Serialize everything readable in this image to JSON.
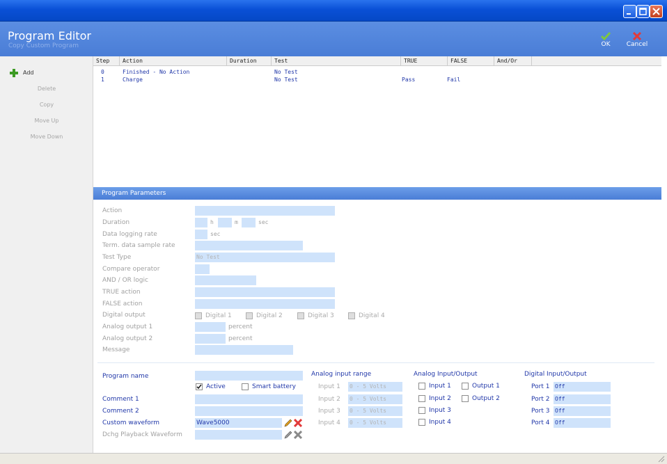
{
  "window": {
    "title": ""
  },
  "header": {
    "title": "Program Editor",
    "subtitle": "Copy Custom Program",
    "ok_label": "OK",
    "cancel_label": "Cancel"
  },
  "sidebar": {
    "items": [
      {
        "label": "Add",
        "enabled": true
      },
      {
        "label": "Delete",
        "enabled": false
      },
      {
        "label": "Copy",
        "enabled": false
      },
      {
        "label": "Move Up",
        "enabled": false
      },
      {
        "label": "Move Down",
        "enabled": false
      }
    ]
  },
  "table": {
    "columns": [
      "Step",
      "Action",
      "Duration",
      "Test",
      "TRUE",
      "FALSE",
      "And/Or"
    ],
    "rows": [
      {
        "step": "0",
        "action": "Finished - No Action",
        "duration": "",
        "test": "No Test",
        "true": "",
        "false": "",
        "andor": ""
      },
      {
        "step": "1",
        "action": "Charge",
        "duration": "",
        "test": "No Test",
        "true": "Pass",
        "false": "Fail",
        "andor": ""
      }
    ]
  },
  "params": {
    "section_title": "Program Parameters",
    "labels": {
      "action": "Action",
      "duration": "Duration",
      "data_logging_rate": "Data logging rate",
      "term_rate": "Term. data sample rate",
      "test_type": "Test Type",
      "compare_operator": "Compare operator",
      "and_or": "AND / OR logic",
      "true_action": "TRUE action",
      "false_action": "FALSE action",
      "digital_output": "Digital output",
      "analog_output_1": "Analog output 1",
      "analog_output_2": "Analog output 2",
      "message": "Message"
    },
    "units": {
      "h": "h",
      "m": "m",
      "sec": "sec",
      "percent": "percent"
    },
    "test_type_value": "No Test",
    "digital_outputs": [
      "Digital 1",
      "Digital 2",
      "Digital 3",
      "Digital 4"
    ]
  },
  "program": {
    "labels": {
      "name": "Program name",
      "comment1": "Comment 1",
      "comment2": "Comment 2",
      "custom_waveform": "Custom waveform",
      "dchg": "Dchg Playback Waveform"
    },
    "active_label": "Active",
    "active_checked": true,
    "smart_battery_label": "Smart battery",
    "smart_battery_checked": false,
    "custom_waveform_value": "Wave5000"
  },
  "analog_range": {
    "title": "Analog input range",
    "inputs": [
      {
        "label": "Input 1",
        "value": "0 -  5 Volts"
      },
      {
        "label": "Input 2",
        "value": "0 -  5 Volts"
      },
      {
        "label": "Input 3",
        "value": "0 -  5 Volts"
      },
      {
        "label": "Input 4",
        "value": "0 -  5 Volts"
      }
    ]
  },
  "analog_io": {
    "title": "Analog Input/Output",
    "inputs": [
      "Input 1",
      "Input 2",
      "Input 3",
      "Input 4"
    ],
    "outputs": [
      "Output 1",
      "Output 2"
    ]
  },
  "digital_io": {
    "title": "Digital Input/Output",
    "ports": [
      {
        "label": "Port 1",
        "value": "Off"
      },
      {
        "label": "Port 2",
        "value": "Off"
      },
      {
        "label": "Port 3",
        "value": "Off"
      },
      {
        "label": "Port 4",
        "value": "Off"
      }
    ]
  },
  "colors": {
    "accent": "#4a7dd6",
    "field": "#cfe3fb",
    "label_blue": "#1f36a8"
  }
}
